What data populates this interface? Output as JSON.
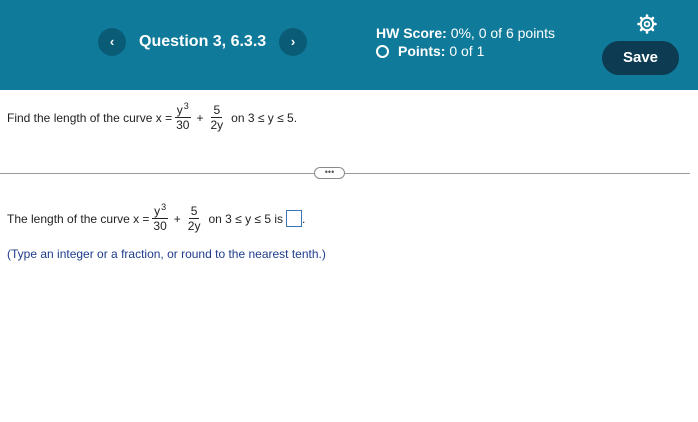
{
  "header": {
    "prev_icon": "chevron-left-icon",
    "prev_glyph": "‹",
    "next_icon": "chevron-right-icon",
    "next_glyph": "›",
    "question_label": "Question 3, 6.3.3",
    "hw_score_label": "HW Score:",
    "hw_score_value": "0%, 0 of 6 points",
    "points_label": "Points:",
    "points_value": "0 of 1",
    "settings_icon": "gear-icon",
    "save_label": "Save",
    "background_color": "#0f7a9a"
  },
  "problem": {
    "prefix": "Find the length of the curve x =",
    "frac1_num": "y",
    "frac1_exp": "3",
    "frac1_den": "30",
    "plus": "+",
    "frac2_num": "5",
    "frac2_den": "2y",
    "range": "on 3 ≤ y ≤ 5."
  },
  "expand_label": "•••",
  "answer": {
    "prefix": "The length of the curve x =",
    "frac1_num": "y",
    "frac1_exp": "3",
    "frac1_den": "30",
    "plus": "+",
    "frac2_num": "5",
    "frac2_den": "2y",
    "range": "on 3 ≤ y ≤ 5 is",
    "period": ".",
    "hint": "(Type an integer or a fraction, or round to the nearest tenth.)"
  }
}
